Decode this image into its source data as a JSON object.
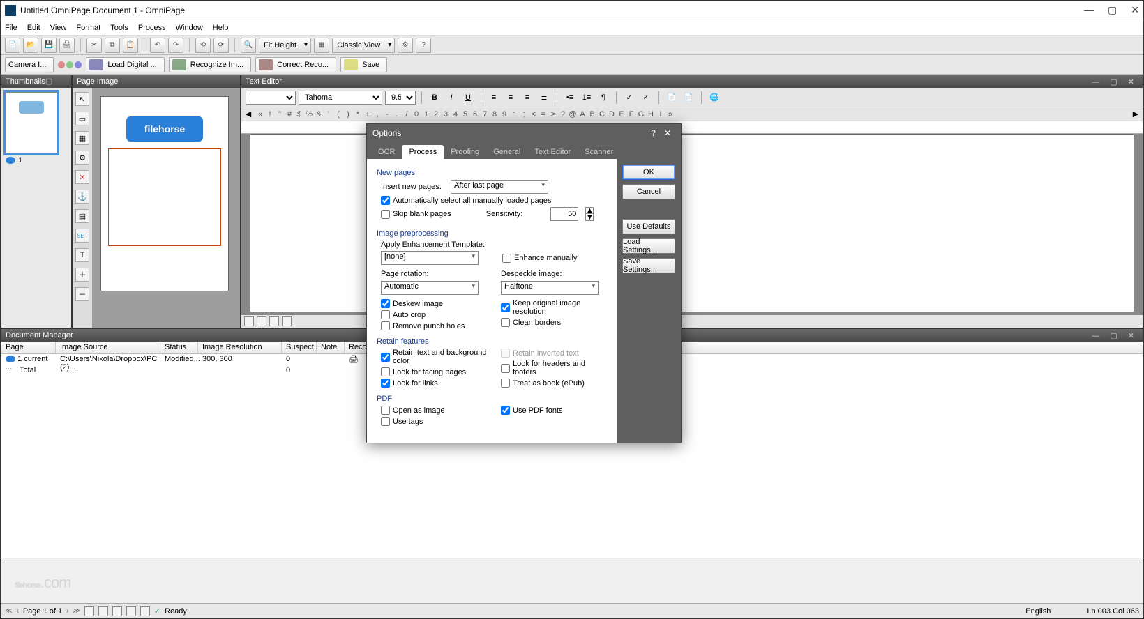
{
  "title": "Untitled OmniPage Document 1 - OmniPage",
  "menu": [
    "File",
    "Edit",
    "View",
    "Format",
    "Tools",
    "Process",
    "Window",
    "Help"
  ],
  "toolbar": {
    "fit": "Fit Height",
    "view": "Classic View"
  },
  "workflow": {
    "camera": "Camera I...",
    "load": "Load Digital ...",
    "recognize": "Recognize Im...",
    "correct": "Correct Reco...",
    "save": "Save"
  },
  "panels": {
    "thumbnails": "Thumbnails",
    "page_image": "Page Image",
    "text_editor": "Text Editor",
    "doc_manager": "Document Manager"
  },
  "logo_text": "filehorse",
  "thumb_page": "1",
  "editor": {
    "font": "Tahoma",
    "size": "9.5"
  },
  "charbar": [
    "«",
    "!",
    "\"",
    "#",
    "$",
    "%",
    "&",
    "'",
    "(",
    ")",
    "*",
    "+",
    ",",
    "-",
    ".",
    "/",
    "0",
    "1",
    "2",
    "3",
    "4",
    "5",
    "6",
    "7",
    "8",
    "9",
    ":",
    ";",
    "<",
    "=",
    ">",
    "?",
    "@",
    "A",
    "B",
    "C",
    "D",
    "E",
    "F",
    "G",
    "H",
    "I",
    "»"
  ],
  "dm": {
    "cols": [
      "Page",
      "Image Source",
      "Status",
      "Image Resolution",
      "Suspect...",
      "Note",
      "Recog..."
    ],
    "row1": {
      "page": "1 current ...",
      "source": "C:\\Users\\Nikola\\Dropbox\\PC (2)...",
      "status": "Modified...",
      "res": "300, 300",
      "suspect": "0"
    },
    "row2": {
      "page": "Total",
      "suspect": "0"
    }
  },
  "watermark": "filehorse",
  "watermark_ext": ".com",
  "status": {
    "page": "Page 1 of 1",
    "ready": "Ready",
    "lang": "English",
    "pos": "Ln 003  Col 063"
  },
  "dialog": {
    "title": "Options",
    "tabs": [
      "OCR",
      "Process",
      "Proofing",
      "General",
      "Text Editor",
      "Scanner"
    ],
    "new_pages": "New pages",
    "insert_label": "Insert new pages:",
    "insert_value": "After last page",
    "auto_select": "Automatically select all manually loaded pages",
    "skip_blank": "Skip blank pages",
    "sensitivity": "Sensitivity:",
    "sensitivity_val": "50",
    "img_preproc": "Image preprocessing",
    "enh_label": "Apply Enhancement Template:",
    "enh_value": "[none]",
    "enh_manual": "Enhance manually",
    "rotation_label": "Page rotation:",
    "rotation_value": "Automatic",
    "despeckle_label": "Despeckle image:",
    "despeckle_value": "Halftone",
    "deskew": "Deskew image",
    "keep_res": "Keep original image resolution",
    "autocrop": "Auto crop",
    "clean_borders": "Clean borders",
    "punch": "Remove punch holes",
    "retain": "Retain features",
    "retain_color": "Retain text and background color",
    "retain_inverted": "Retain inverted text",
    "facing": "Look for facing pages",
    "headers": "Look for headers and footers",
    "links": "Look for links",
    "epub": "Treat as book (ePub)",
    "pdf": "PDF",
    "open_image": "Open as image",
    "pdf_fonts": "Use PDF fonts",
    "use_tags": "Use tags",
    "ok": "OK",
    "cancel": "Cancel",
    "defaults": "Use Defaults",
    "load_settings": "Load Settings...",
    "save_settings": "Save Settings..."
  }
}
